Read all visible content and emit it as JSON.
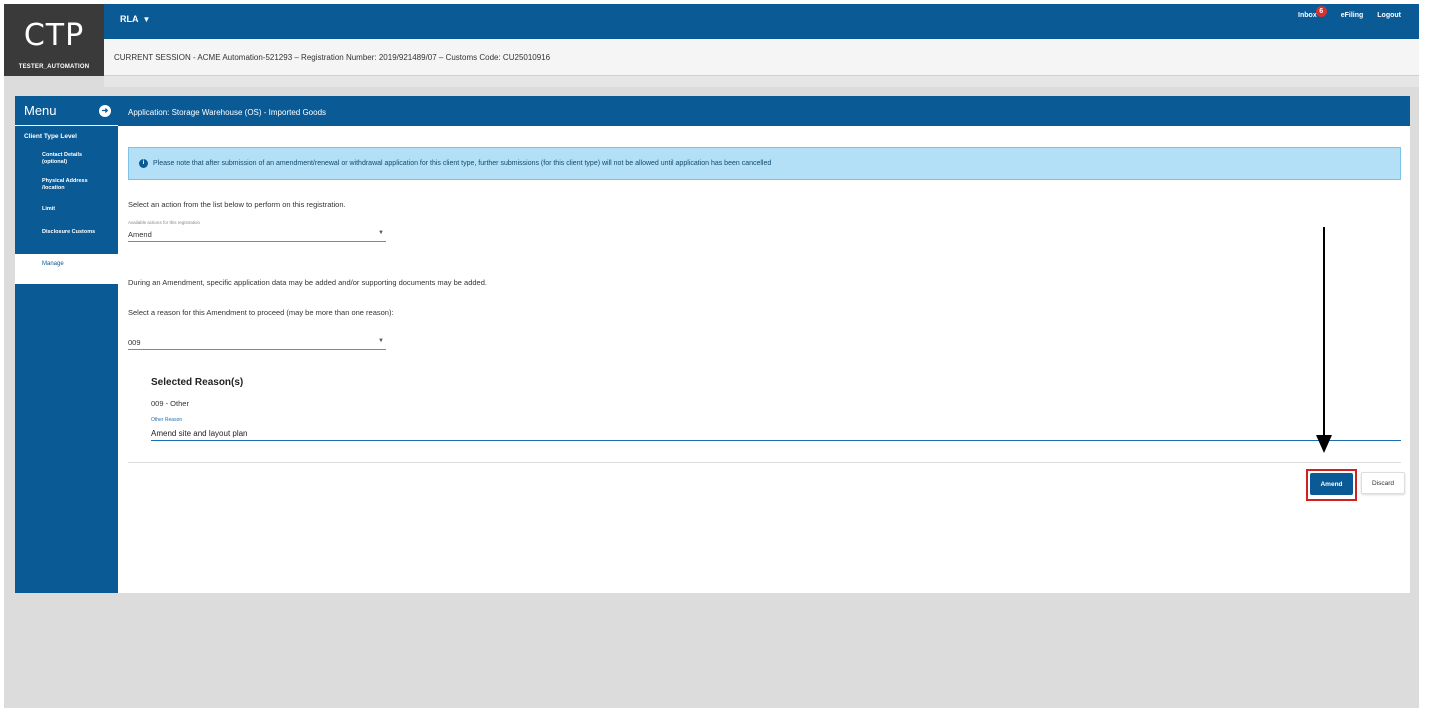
{
  "brand": {
    "logo": "CTP",
    "user": "TESTER_AUTOMATION"
  },
  "topbar": {
    "menu_label": "RLA",
    "inbox_label": "Inbox",
    "inbox_count": "6",
    "efiling_label": "eFiling",
    "logout_label": "Logout"
  },
  "session": {
    "text": "CURRENT SESSION - ACME Automation-521293 – Registration Number: 2019/921489/07 – Customs Code: CU25010916"
  },
  "sidebar": {
    "title": "Menu",
    "group": "Client Type Level",
    "items": [
      {
        "line1": "Contact Details",
        "line2": "(optional)"
      },
      {
        "line1": "Physical Address",
        "line2": "/location"
      },
      {
        "line1": "Limit",
        "line2": ""
      },
      {
        "line1": "Disclosure Customs",
        "line2": ""
      }
    ],
    "active_item": "Manage"
  },
  "main": {
    "header": "Application: Storage Warehouse (OS) - Imported Goods",
    "notice": "Please note that after submission of an amendment/renewal or withdrawal application for this client type, further submissions (for this client type) will not be allowed until application has been cancelled",
    "select_action_prompt": "Select an action from the list below to perform on this registration.",
    "action_select_label": "Available actions for this registration",
    "action_select_value": "Amend",
    "amendment_info": "During an Amendment, specific application data may be added and/or supporting documents may be added.",
    "reason_prompt": "Select a reason for this Amendment to proceed (may be more than one reason):",
    "reason_select_value": "009",
    "selected_reasons_title": "Selected Reason(s)",
    "selected_reason_item": "009 - Other",
    "other_reason_label": "Other Reason",
    "other_reason_value": "Amend site and layout plan",
    "amend_button": "Amend",
    "discard_button": "Discard"
  },
  "colors": {
    "primary": "#0a5a96",
    "notice_bg": "#b3e0f7",
    "highlight": "#d02020",
    "badge": "#d9302c"
  }
}
